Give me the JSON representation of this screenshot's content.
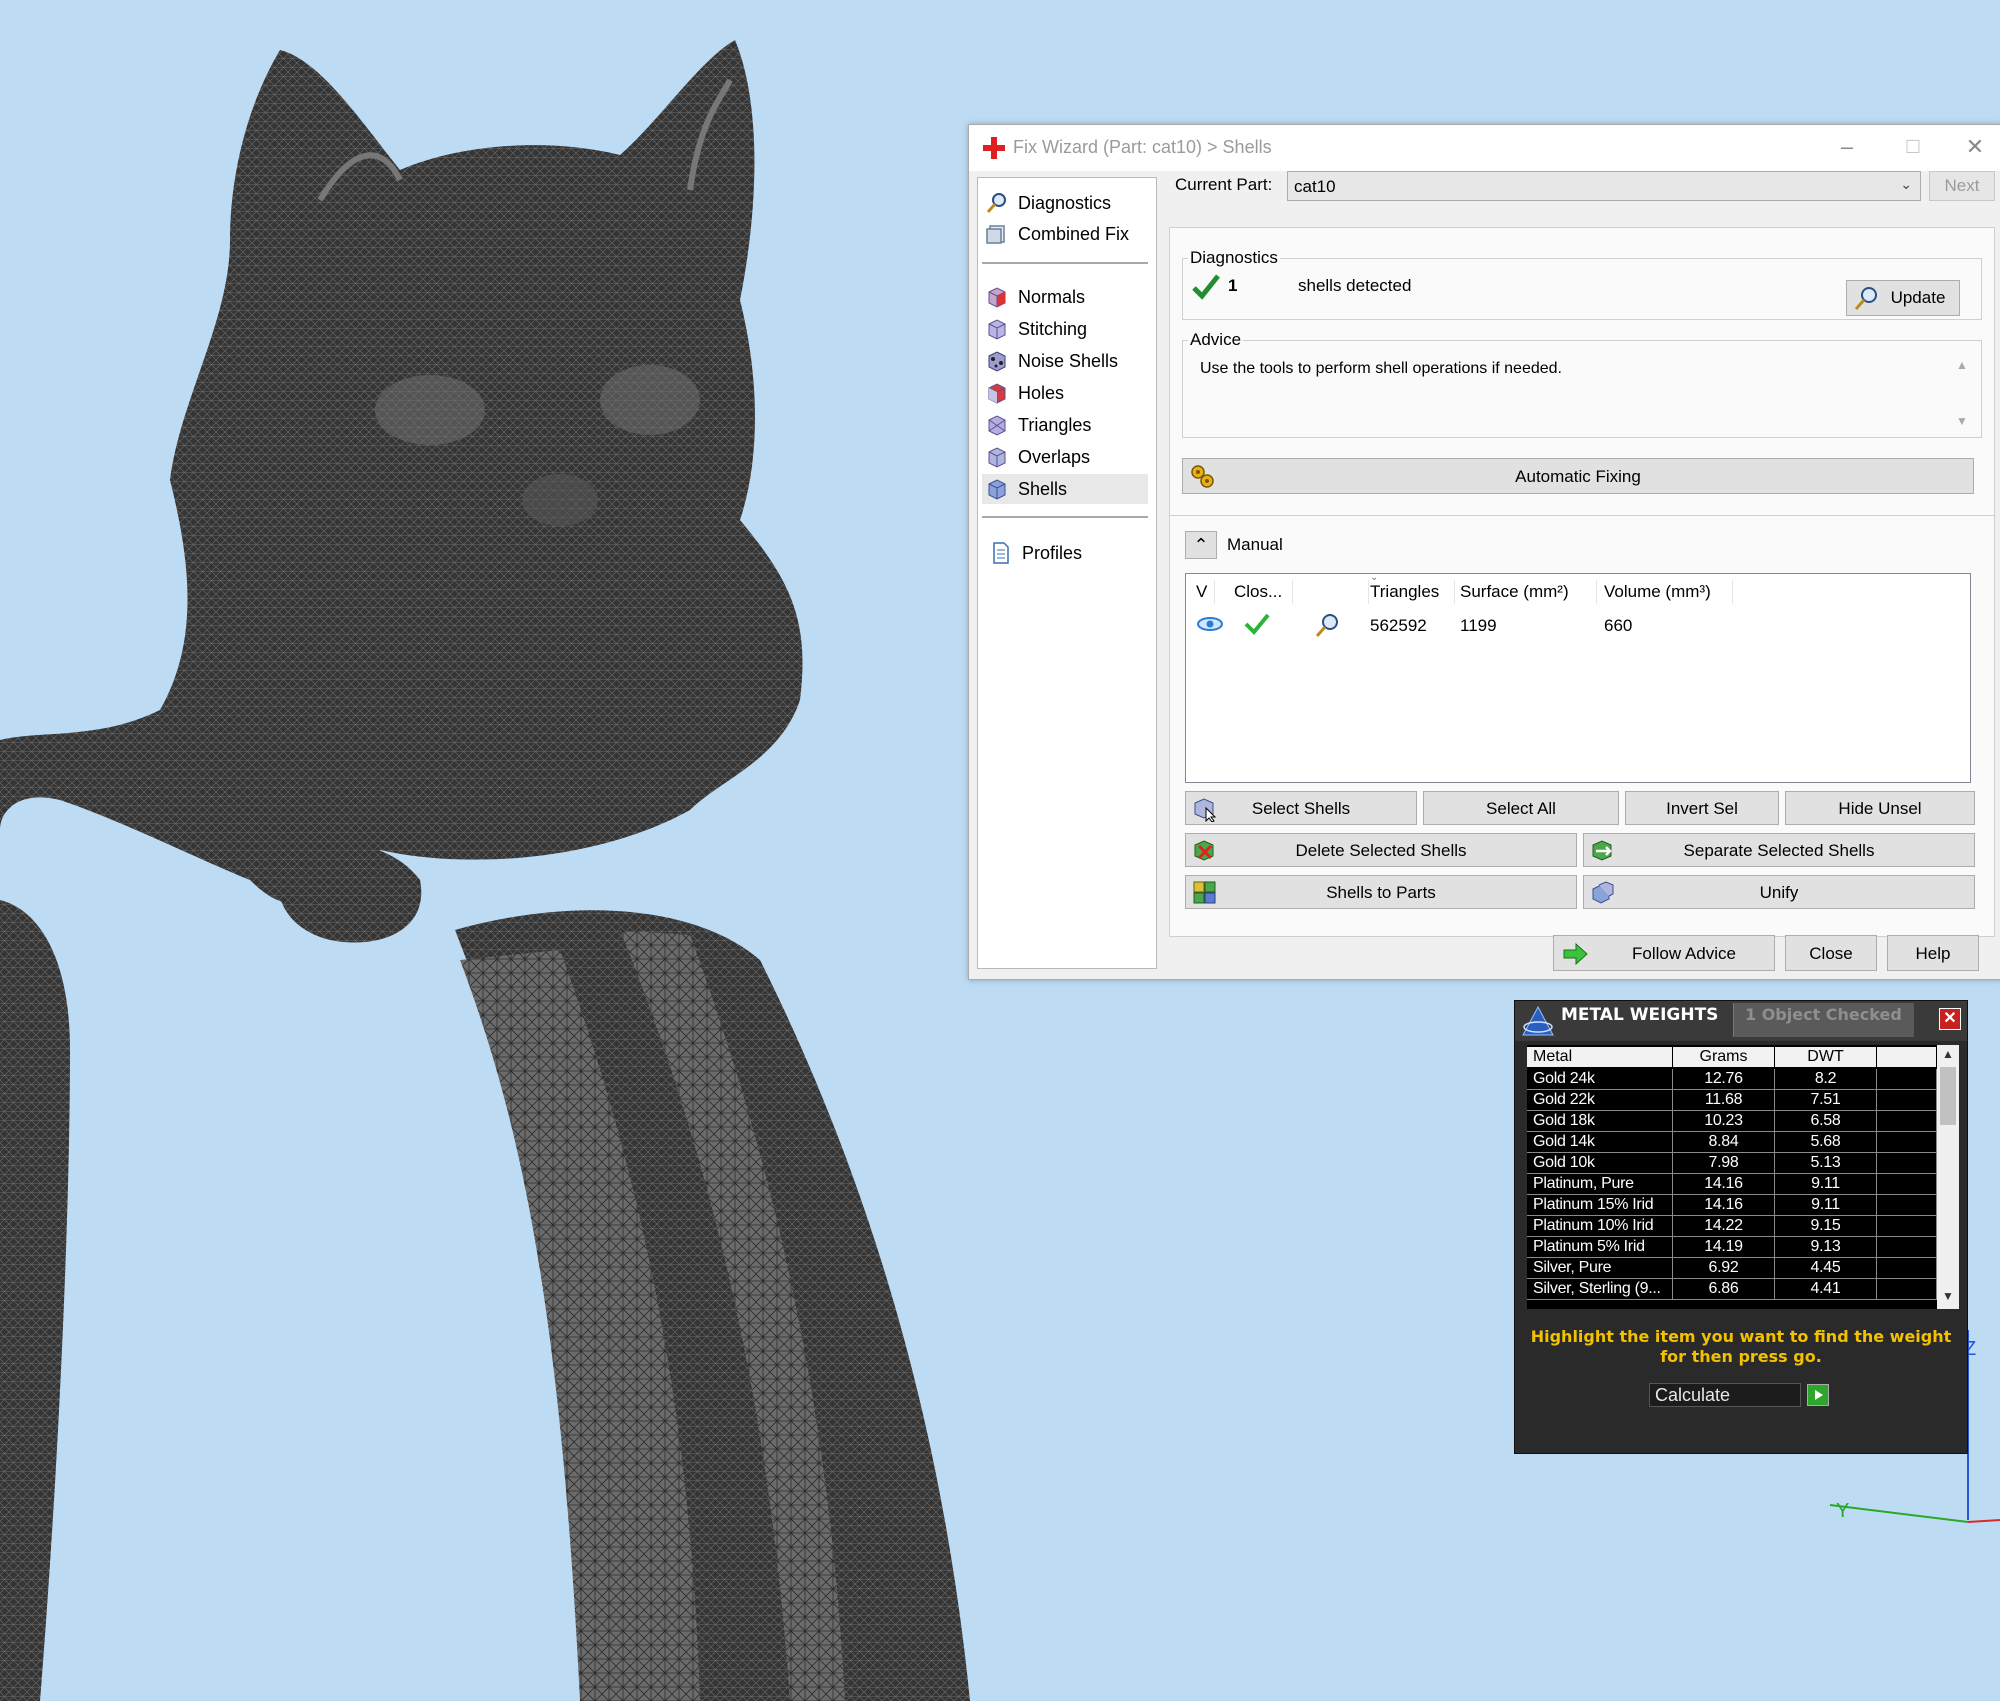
{
  "wizard": {
    "title": "Fix Wizard (Part: cat10) > Shells",
    "nav": {
      "items": [
        {
          "label": "Diagnostics",
          "icon": "magnifier-icon"
        },
        {
          "label": "Combined Fix",
          "icon": "combined-fix-icon"
        },
        {
          "label": "Normals",
          "icon": "normals-cube-icon"
        },
        {
          "label": "Stitching",
          "icon": "stitching-cube-icon"
        },
        {
          "label": "Noise Shells",
          "icon": "noise-shells-cube-icon"
        },
        {
          "label": "Holes",
          "icon": "holes-cube-icon"
        },
        {
          "label": "Triangles",
          "icon": "triangles-cube-icon"
        },
        {
          "label": "Overlaps",
          "icon": "overlaps-cube-icon"
        },
        {
          "label": "Shells",
          "icon": "shells-cube-icon"
        },
        {
          "label": "Profiles",
          "icon": "document-icon"
        }
      ],
      "selected": "Shells"
    },
    "current_part_label": "Current Part:",
    "current_part_value": "cat10",
    "next_button": "Next",
    "diagnostics": {
      "group_label": "Diagnostics",
      "count": "1",
      "text": "shells detected",
      "update_button": "Update"
    },
    "advice": {
      "group_label": "Advice",
      "text": "Use the tools to perform shell operations if needed."
    },
    "automatic_fixing_button": "Automatic Fixing",
    "manual": {
      "label": "Manual",
      "columns": [
        "V",
        "Clos...",
        "",
        "Triangles",
        "Surface (mm²)",
        "Volume (mm³)"
      ],
      "rows": [
        {
          "triangles": "562592",
          "surface": "1199",
          "volume": "660"
        }
      ]
    },
    "buttons": {
      "select_shells": "Select Shells",
      "select_all": "Select All",
      "invert_sel": "Invert Sel",
      "hide_unsel": "Hide Unsel",
      "delete_selected": "Delete Selected Shells",
      "separate_selected": "Separate Selected Shells",
      "shells_to_parts": "Shells to Parts",
      "unify": "Unify",
      "follow_advice": "Follow Advice",
      "close": "Close",
      "help": "Help"
    }
  },
  "metal_weights": {
    "title": "METAL WEIGHTS",
    "subtitle": "1 Object Checked",
    "columns": [
      "Metal",
      "Grams",
      "DWT"
    ],
    "rows": [
      {
        "metal": "Gold 24k",
        "grams": "12.76",
        "dwt": "8.2"
      },
      {
        "metal": "Gold 22k",
        "grams": "11.68",
        "dwt": "7.51"
      },
      {
        "metal": "Gold 18k",
        "grams": "10.23",
        "dwt": "6.58"
      },
      {
        "metal": "Gold 14k",
        "grams": "8.84",
        "dwt": "5.68"
      },
      {
        "metal": "Gold 10k",
        "grams": "7.98",
        "dwt": "5.13"
      },
      {
        "metal": "Platinum, Pure",
        "grams": "14.16",
        "dwt": "9.11"
      },
      {
        "metal": "Platinum 15% Irid",
        "grams": "14.16",
        "dwt": "9.11"
      },
      {
        "metal": "Platinum 10% Irid",
        "grams": "14.22",
        "dwt": "9.15"
      },
      {
        "metal": "Platinum 5% Irid",
        "grams": "14.19",
        "dwt": "9.13"
      },
      {
        "metal": "Silver, Pure",
        "grams": "6.92",
        "dwt": "4.45"
      },
      {
        "metal": "Silver, Sterling (9...",
        "grams": "6.86",
        "dwt": "4.41"
      }
    ],
    "instruction": "Highlight the item you want to find the weight for then press go.",
    "calculate_label": "Calculate"
  },
  "axes": {
    "z": "Z",
    "y": "Y"
  },
  "colors": {
    "viewport_bg": "#bddcf4",
    "model": "#3a3a3a",
    "metal_text": "#f2c200",
    "go_button": "#2ea62e"
  }
}
